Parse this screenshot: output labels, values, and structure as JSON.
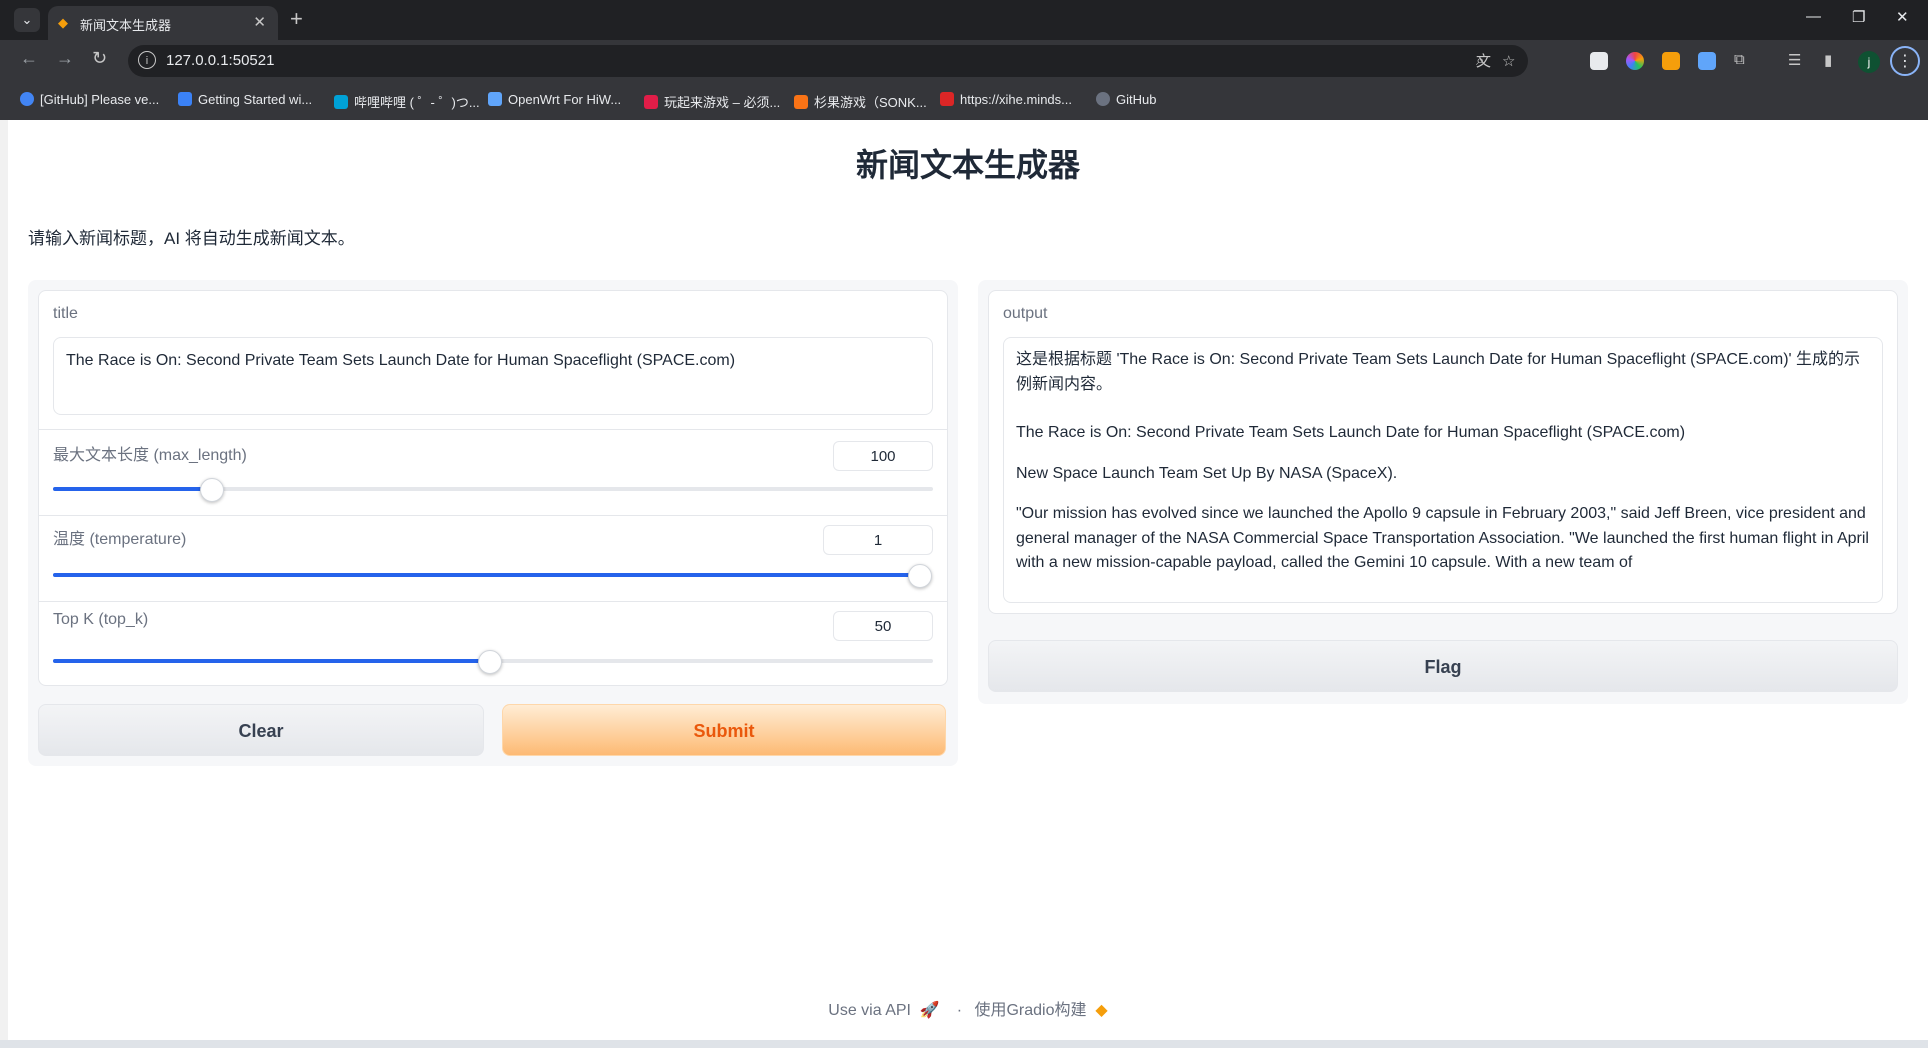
{
  "browser": {
    "tab_title": "新闻文本生成器",
    "url": "127.0.0.1:50521",
    "bookmarks": [
      {
        "label": "[GitHub] Please ve...",
        "color": "#4285f4"
      },
      {
        "label": "Getting Started wi...",
        "color": "#3b82f6"
      },
      {
        "label": "哔哩哔哩 ( ゜- ゜)つ...",
        "color": "#00a1d6"
      },
      {
        "label": "OpenWrt For HiW...",
        "color": "#60a5fa"
      },
      {
        "label": "玩起来游戏 – 必须...",
        "color": "#e11d48"
      },
      {
        "label": "杉果游戏（SONK...",
        "color": "#f97316"
      },
      {
        "label": "https://xihe.minds...",
        "color": "#dc2626"
      },
      {
        "label": "GitHub",
        "color": "#6b7280"
      }
    ]
  },
  "page": {
    "title": "新闻文本生成器",
    "description": "请输入新闻标题，AI 将自动生成新闻文本。"
  },
  "inputs": {
    "title_label": "title",
    "title_value": "The Race is On: Second Private Team Sets Launch Date for Human Spaceflight (SPACE.com)",
    "max_length": {
      "label": "最大文本长度 (max_length)",
      "value": "100",
      "fraction": 0.18
    },
    "temperature": {
      "label": "温度 (temperature)",
      "value": "1",
      "fraction": 1.0
    },
    "top_k": {
      "label": "Top K (top_k)",
      "value": "50",
      "fraction": 0.495
    }
  },
  "buttons": {
    "clear": "Clear",
    "submit": "Submit",
    "flag": "Flag"
  },
  "output": {
    "label": "output",
    "paragraphs": [
      "这是根据标题 'The Race is On: Second Private Team Sets Launch Date for Human Spaceflight (SPACE.com)' 生成的示例新闻内容。",
      "The Race is On: Second Private Team Sets Launch Date for Human Spaceflight (SPACE.com)",
      "New Space Launch Team Set Up By NASA (SpaceX).",
      "\"Our mission has evolved since we launched the Apollo 9 capsule in February 2003,\" said Jeff Breen, vice president and general manager of the NASA Commercial Space Transportation Association. \"We launched the first human flight in April with a new mission-capable payload, called the Gemini 10 capsule. With a new team of"
    ]
  },
  "footer": {
    "api": "Use via API",
    "separator": "·",
    "built_with": "使用Gradio构建"
  },
  "colors": {
    "accent": "#2563eb",
    "submit_text": "#ea580c",
    "submit_bg": "#fdba74"
  }
}
